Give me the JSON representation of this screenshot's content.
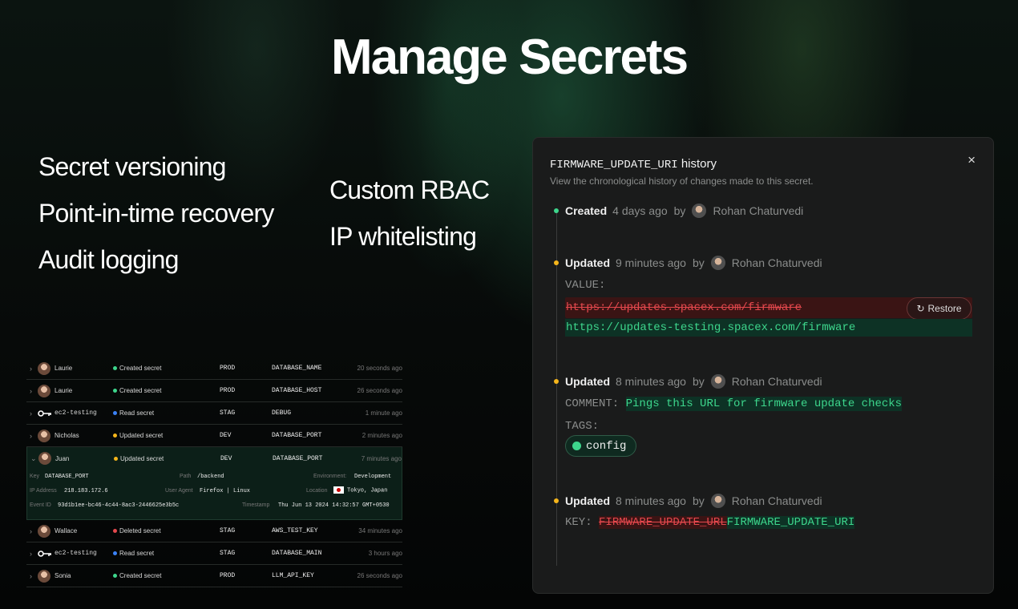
{
  "hero": {
    "title": "Manage Secrets"
  },
  "features": {
    "left": [
      "Secret versioning",
      "Point-in-time recovery",
      "Audit logging"
    ],
    "right": [
      "Custom RBAC",
      "IP whitelisting"
    ]
  },
  "activity": {
    "rows": [
      {
        "actor": "Laurie",
        "action": "Created secret",
        "action_color": "#3dd68c",
        "env": "PROD",
        "secret": "DATABASE_NAME",
        "time": "20 seconds ago"
      },
      {
        "actor": "Laurie",
        "action": "Created secret",
        "action_color": "#3dd68c",
        "env": "PROD",
        "secret": "DATABASE_HOST",
        "time": "26 seconds ago"
      },
      {
        "actor": "ec2-testing",
        "action": "Read secret",
        "action_color": "#3b82f6",
        "env": "STAG",
        "secret": "DEBUG",
        "time": "1 minute ago"
      },
      {
        "actor": "Nicholas",
        "action": "Updated secret",
        "action_color": "#f5b51b",
        "env": "DEV",
        "secret": "DATABASE_PORT",
        "time": "2 minutes ago"
      }
    ],
    "expanded": {
      "actor": "Juan",
      "action": "Updated secret",
      "action_color": "#f5b51b",
      "env": "DEV",
      "secret": "DATABASE_PORT",
      "time": "7 minutes ago",
      "labels": {
        "key": "Key",
        "path": "Path",
        "environment": "Environment:",
        "ip": "IP Address",
        "user_agent": "User Agent",
        "location": "Location",
        "event_id": "Event ID",
        "timestamp": "Timestamp"
      },
      "key": "DATABASE_PORT",
      "path": "/backend",
      "environment": "Development",
      "ip": "218.183.172.6",
      "user_agent": "Firefox | Linux",
      "location": "Tokyo, Japan",
      "event_id": "93d1b1ee-bc46-4c44-8ac3-2446625e3b5c",
      "timestamp": "Thu Jun 13 2024 14:32:57 GMT+0530"
    },
    "rows_after": [
      {
        "actor": "Wallace",
        "action": "Deleted secret",
        "action_color": "#e5484d",
        "env": "STAG",
        "secret": "AWS_TEST_KEY",
        "time": "34 minutes ago"
      },
      {
        "actor": "ec2-testing",
        "action": "Read secret",
        "action_color": "#3b82f6",
        "env": "STAG",
        "secret": "DATABASE_MAIN",
        "time": "3 hours ago"
      },
      {
        "actor": "Sonia",
        "action": "Created secret",
        "action_color": "#3dd68c",
        "env": "PROD",
        "secret": "LLM_API_KEY",
        "time": "26 seconds ago"
      }
    ]
  },
  "history": {
    "secret_name": "FIRMWARE_UPDATE_URI",
    "title_suffix": "history",
    "subtitle": "View the chronological history of changes made to this secret.",
    "close": "×",
    "events": [
      {
        "kind": "Created",
        "when": "4 days ago",
        "by": "by",
        "user": "Rohan Chaturvedi",
        "dot": "#3dd68c"
      },
      {
        "kind": "Updated",
        "when": "9 minutes ago",
        "by": "by",
        "user": "Rohan Chaturvedi",
        "dot": "#f5b51b"
      },
      {
        "kind": "Updated",
        "when": "8 minutes ago",
        "by": "by",
        "user": "Rohan Chaturvedi",
        "dot": "#f5b51b"
      },
      {
        "kind": "Updated",
        "when": "8 minutes ago",
        "by": "by",
        "user": "Rohan Chaturvedi",
        "dot": "#f5b51b"
      }
    ],
    "value_label": "VALUE:",
    "value_old": "https://updates.spacex.com/firmware",
    "value_new": "https://updates-testing.spacex.com/firmware",
    "restore_label": "Restore",
    "comment_label": "COMMENT:",
    "comment_value": "Pings this URL for firmware update checks",
    "tags_label": "TAGS:",
    "tag": "config",
    "key_label": "KEY:",
    "key_old": "FIRMWARE_UPDATE_URL",
    "key_new": "FIRMWARE_UPDATE_URI"
  }
}
